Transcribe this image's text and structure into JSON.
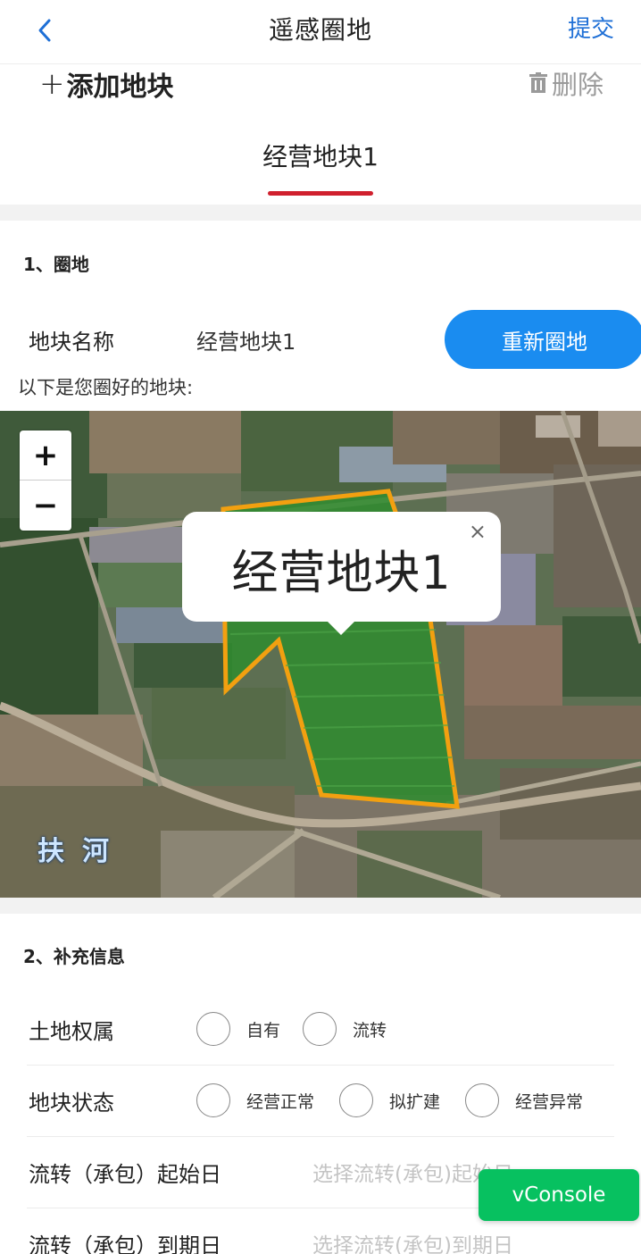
{
  "nav": {
    "title": "遥感圈地",
    "submit": "提交"
  },
  "actions": {
    "add": "添加地块",
    "add_icon": "+",
    "delete": "删除"
  },
  "tabs": [
    {
      "label": "经营地块1",
      "active": true
    }
  ],
  "section1": {
    "title": "1、圈地",
    "plot_name_label": "地块名称",
    "plot_name_value": "经营地块1",
    "redraw_button": "重新圈地",
    "hint": "以下是您圈好的地块:"
  },
  "map": {
    "zoom_in": "+",
    "zoom_out": "−",
    "popup_text": "经营地块1",
    "popup_close": "×",
    "river_label": "扶河"
  },
  "section2": {
    "title": "2、补充信息",
    "ownership": {
      "label": "土地权属",
      "options": [
        "自有",
        "流转"
      ]
    },
    "status": {
      "label": "地块状态",
      "options": [
        "经营正常",
        "拟扩建",
        "经营异常"
      ]
    },
    "start_date": {
      "label": "流转（承包）起始日",
      "placeholder": "选择流转(承包)起始日"
    },
    "end_date": {
      "label": "流转（承包）到期日",
      "placeholder": "选择流转(承包)到期日"
    }
  },
  "debug": {
    "vconsole": "vConsole"
  },
  "colors": {
    "accent": "#1e6fd6",
    "button": "#1a8cf0",
    "tab_underline": "#d0202e",
    "polygon_stroke": "#f2a010",
    "vconsole": "#07c160"
  }
}
